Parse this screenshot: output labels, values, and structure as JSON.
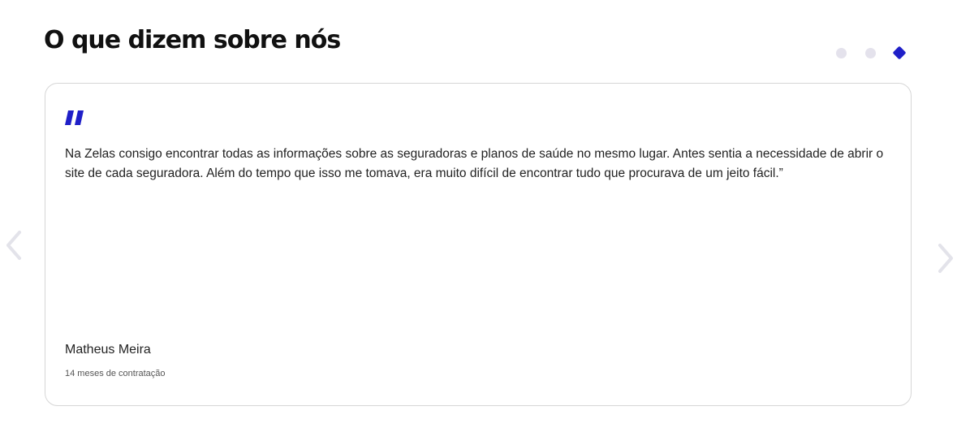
{
  "section": {
    "title": "O que dizem sobre nós"
  },
  "carousel": {
    "dot_count": 3,
    "active_index": 3,
    "prev_label": "previous-arrow",
    "next_label": "next-arrow",
    "accent_color": "#1f1fc8",
    "inactive_dot_color": "#e4e2ec"
  },
  "testimonial": {
    "quote_icon": "quote-icon",
    "text": "Na Zelas consigo encontrar todas as informações sobre as seguradoras e planos de saúde no mesmo lugar. Antes sentia a necessidade de abrir o site de cada seguradora. Além do tempo que isso me tomava, era muito difícil de encontrar tudo que procurava de um jeito fácil.”",
    "author": "Matheus Meira",
    "meta": "14 meses de contratação"
  }
}
